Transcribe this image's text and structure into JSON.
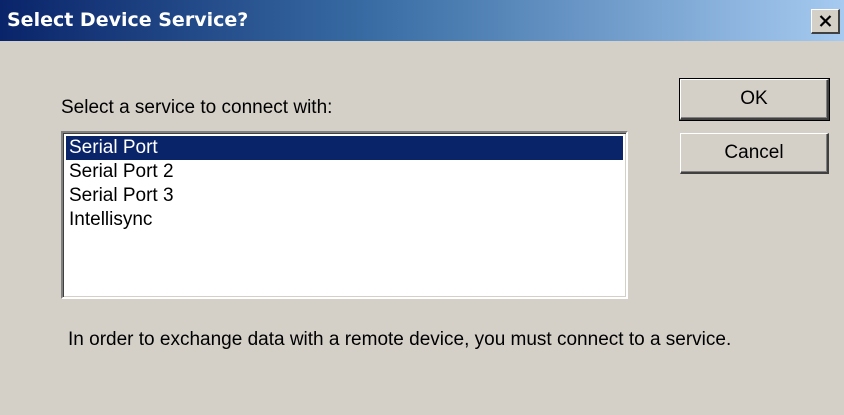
{
  "window": {
    "title": "Select Device Service?",
    "close_glyph": "×",
    "close_icon": "close-icon"
  },
  "prompt_label": "Select a service to connect with:",
  "services": {
    "items": [
      {
        "label": "Serial Port",
        "selected": true
      },
      {
        "label": "Serial Port 2",
        "selected": false
      },
      {
        "label": "Serial Port 3",
        "selected": false
      },
      {
        "label": "Intellisync",
        "selected": false
      }
    ]
  },
  "buttons": {
    "ok_label": "OK",
    "cancel_label": "Cancel"
  },
  "footer_text": "In order to exchange data with a remote device, you must connect to a service.",
  "colors": {
    "titlebar_start": "#0a246a",
    "titlebar_end": "#a6caf0",
    "dialog_background": "#d4d0c8",
    "selection": "#0a246a"
  }
}
